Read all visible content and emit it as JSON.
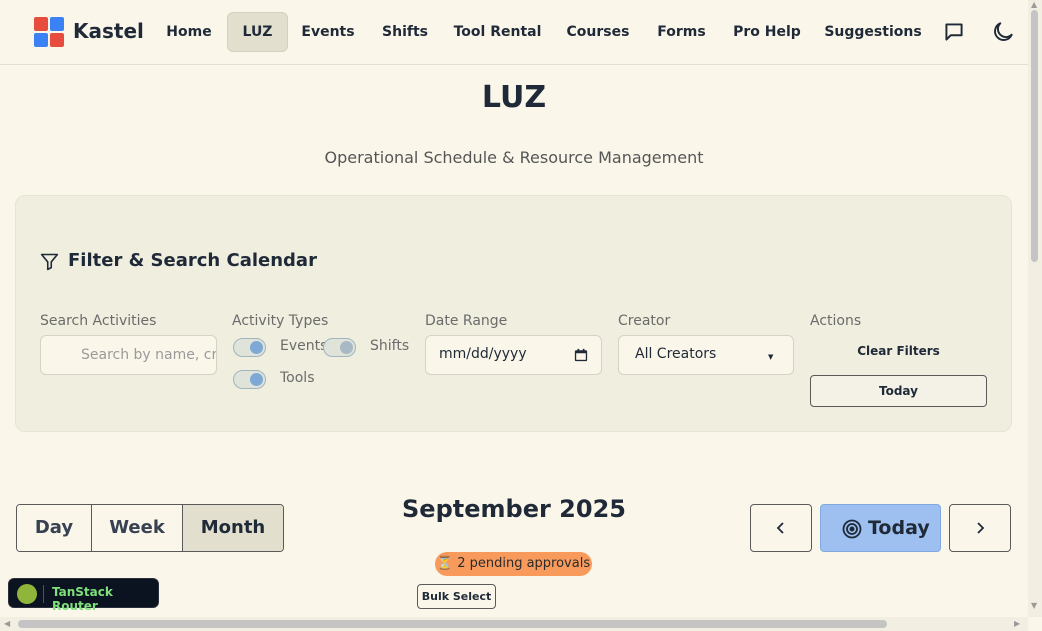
{
  "header": {
    "brand": "Kastel",
    "nav": [
      {
        "label": "Home",
        "active": false
      },
      {
        "label": "LUZ",
        "active": true
      },
      {
        "label": "Events",
        "active": false
      },
      {
        "label": "Shifts",
        "active": false
      },
      {
        "label": "Tool Rental",
        "active": false
      },
      {
        "label": "Courses",
        "active": false
      },
      {
        "label": "Forms",
        "active": false
      },
      {
        "label": "Pro Help",
        "active": false
      },
      {
        "label": "Suggestions",
        "active": false
      }
    ],
    "icons": [
      "message-square-icon",
      "moon-icon"
    ]
  },
  "page": {
    "title": "LUZ",
    "subtitle": "Operational Schedule & Resource Management"
  },
  "filters": {
    "title": "Filter & Search Calendar",
    "search_label": "Search Activities",
    "search_placeholder": "Search by name, creator...",
    "types_label": "Activity Types",
    "types": [
      {
        "label": "Events",
        "on": true
      },
      {
        "label": "Shifts",
        "on": true
      },
      {
        "label": "Tools",
        "on": true
      }
    ],
    "date_label": "Date Range",
    "date_value": "mm/dd/yyyy",
    "creator_label": "Creator",
    "creator_value": "All Creators",
    "actions_label": "Actions",
    "clear_label": "Clear Filters",
    "today_label": "Today"
  },
  "calendar": {
    "views": [
      {
        "label": "Day",
        "active": false
      },
      {
        "label": "Week",
        "active": false
      },
      {
        "label": "Month",
        "active": true
      }
    ],
    "month_title": "September 2025",
    "today_label": "Today",
    "pending": "⏳ 2 pending approvals",
    "bulk_label": "Bulk Select"
  },
  "devtools": {
    "label": "TanStack Router"
  },
  "colors": {
    "background": "#faf7ea",
    "card": "#efeedf",
    "today_button": "#9dc0f0",
    "pending_badge": "#f79a5c"
  }
}
